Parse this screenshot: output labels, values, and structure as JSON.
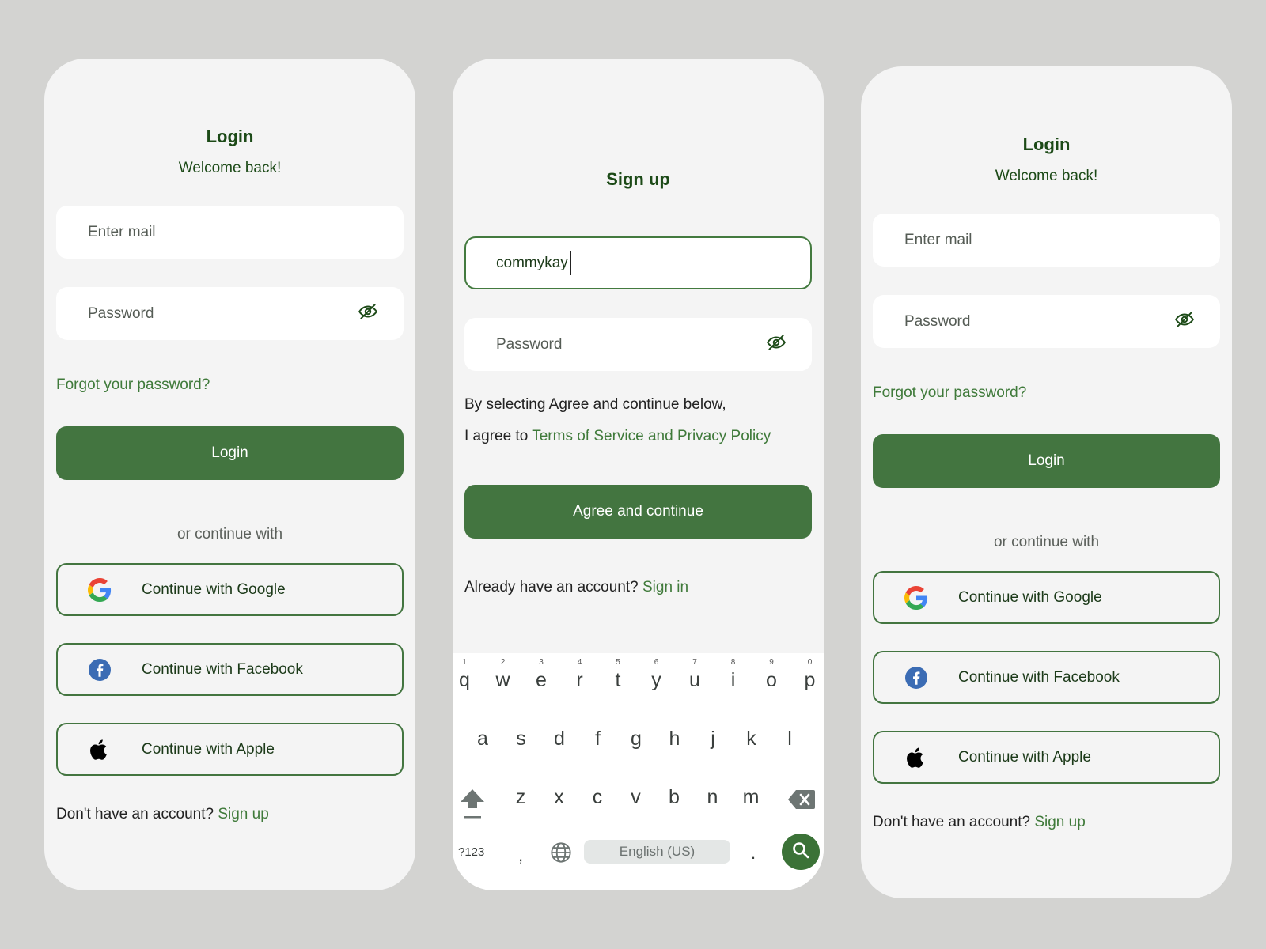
{
  "login_left": {
    "title": "Login",
    "subtitle": "Welcome back!",
    "email_placeholder": "Enter mail",
    "password_placeholder": "Password",
    "forgot_label": "Forgot your password?",
    "login_label": "Login",
    "divider_label": "or continue with",
    "google_label": "Continue with Google",
    "facebook_label": "Continue with Facebook",
    "apple_label": "Continue with Apple",
    "no_account_text": "Don't have an account?",
    "signup_link": "Sign up"
  },
  "signup": {
    "title": "Sign up",
    "username_value": "commykay",
    "password_placeholder": "Password",
    "terms_line1": "By selecting Agree and continue below,",
    "terms_line2_prefix": "I agree to",
    "terms_link": "Terms of Service and Privacy Policy",
    "agree_label": "Agree and continue",
    "have_account_text": "Already have an account?",
    "signin_link": "Sign in"
  },
  "keyboard": {
    "row1": [
      {
        "key": "q",
        "num": "1"
      },
      {
        "key": "w",
        "num": "2"
      },
      {
        "key": "e",
        "num": "3"
      },
      {
        "key": "r",
        "num": "4"
      },
      {
        "key": "t",
        "num": "5"
      },
      {
        "key": "y",
        "num": "6"
      },
      {
        "key": "u",
        "num": "7"
      },
      {
        "key": "i",
        "num": "8"
      },
      {
        "key": "o",
        "num": "9"
      },
      {
        "key": "p",
        "num": "0"
      }
    ],
    "row2": [
      "a",
      "s",
      "d",
      "f",
      "g",
      "h",
      "j",
      "k",
      "l"
    ],
    "row3": [
      "z",
      "x",
      "c",
      "v",
      "b",
      "n",
      "m"
    ],
    "symbols_key": "?123",
    "comma_key": ",",
    "space_label": "English (US)",
    "period_key": ".",
    "icons": [
      "shift-icon",
      "backspace-icon",
      "globe-icon",
      "search-icon"
    ]
  },
  "login_right": {
    "title": "Login",
    "subtitle": "Welcome back!",
    "email_placeholder": "Enter mail",
    "password_placeholder": "Password",
    "forgot_label": "Forgot your password?",
    "login_label": "Login",
    "divider_label": "or continue with",
    "google_label": "Continue with Google",
    "facebook_label": "Continue with Facebook",
    "apple_label": "Continue with Apple",
    "no_account_text": "Don't have an account?",
    "signup_link": "Sign up"
  },
  "colors": {
    "primary": "#437540",
    "link": "#3f7a3a",
    "title": "#1c4a17",
    "background": "#d3d3d1",
    "card": "#f4f4f4"
  }
}
